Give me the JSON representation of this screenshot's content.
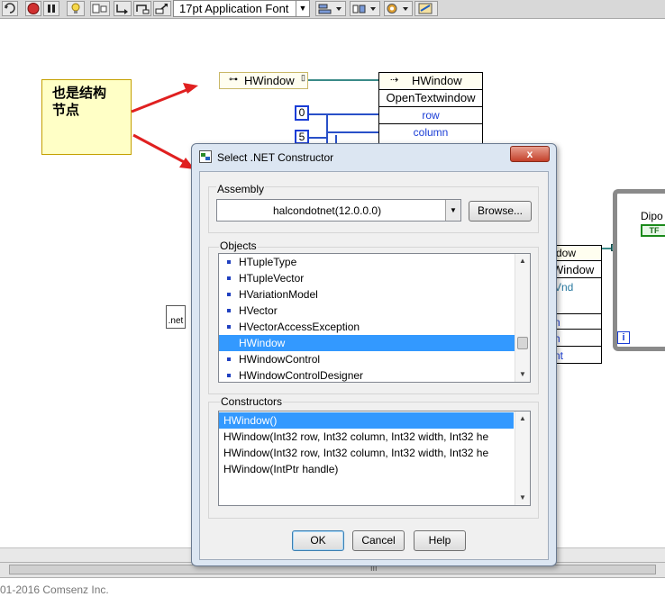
{
  "toolbar": {
    "font_select": "17pt Application Font",
    "icons": [
      "run-continuous-icon",
      "abort-icon",
      "pause-icon",
      "highlight-icon",
      "retain-wire-icon",
      "step-into-icon",
      "step-over-icon",
      "step-out-icon",
      "align-icon",
      "distribute-icon",
      "reorder-icon",
      "cleanup-icon"
    ]
  },
  "note": {
    "text_line1": "也是结构",
    "text_line2": "节点"
  },
  "diagram": {
    "constructor_node_label": "HWindow",
    "invoke_node_title": "HWindow",
    "invoke_method": "OpenTextwindow",
    "param_row": "row",
    "param_column": "column",
    "const_0": "0",
    "const_5": "5",
    "right_node_header": "dow",
    "right_node_title": "Window",
    "right_node_param": "Vnd",
    "frag_rows": [
      "n",
      "h",
      "nt"
    ],
    "dipo_label": "Dipo",
    "tf_label": "TF",
    "loop_index": "i",
    "net_icon_label": ".net"
  },
  "dialog": {
    "title": "Select .NET Constructor",
    "close_label": "x",
    "assembly_label": "Assembly",
    "assembly_value": "halcondotnet(12.0.0.0)",
    "browse_label": "Browse...",
    "objects_label": "Objects",
    "objects": [
      {
        "label": "HTupleType",
        "selected": false
      },
      {
        "label": "HTupleVector",
        "selected": false
      },
      {
        "label": "HVariationModel",
        "selected": false
      },
      {
        "label": "HVector",
        "selected": false
      },
      {
        "label": "HVectorAccessException",
        "selected": false
      },
      {
        "label": "HWindow",
        "selected": true
      },
      {
        "label": "HWindowControl",
        "selected": false
      },
      {
        "label": "HWindowControlDesigner",
        "selected": false
      }
    ],
    "constructors_label": "Constructors",
    "constructors": [
      {
        "label": "HWindow()",
        "selected": true
      },
      {
        "label": "HWindow(Int32 row, Int32 column, Int32 width, Int32 he",
        "selected": false
      },
      {
        "label": "HWindow(Int32 row, Int32 column, Int32 width, Int32 he",
        "selected": false
      },
      {
        "label": "HWindow(IntPtr handle)",
        "selected": false
      }
    ],
    "ok_label": "OK",
    "cancel_label": "Cancel",
    "help_label": "Help"
  },
  "footer": {
    "copyright": "01-2016 Comsenz Inc.",
    "scroll_grip": "III"
  },
  "colors": {
    "selection": "#3399ff",
    "note_bg": "#ffffc6",
    "arrow": "#e02020",
    "lv_blue": "#1a3dd6"
  }
}
